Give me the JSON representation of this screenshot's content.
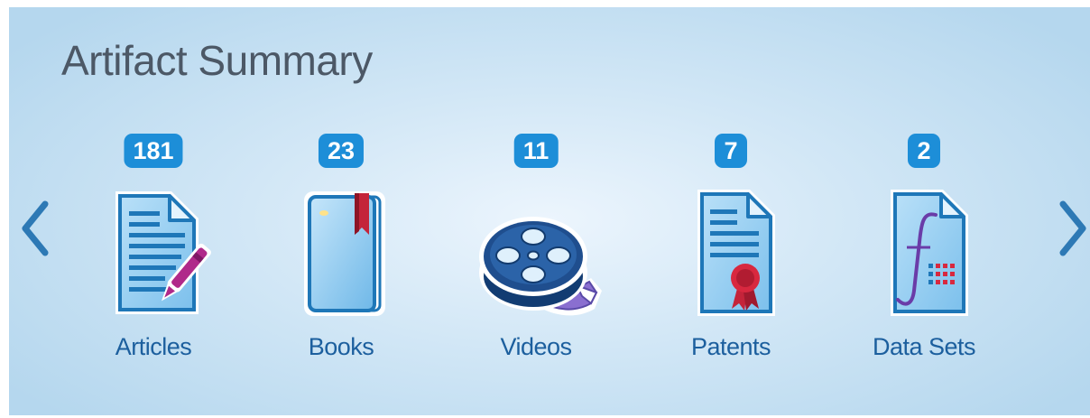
{
  "panel": {
    "title": "Artifact Summary"
  },
  "nav": {
    "prev_icon": "chevron-left-icon",
    "next_icon": "chevron-right-icon"
  },
  "colors": {
    "badge": "#1d8ed8",
    "label": "#1c5f9e",
    "title": "#4c5866",
    "arrow": "#2d79b5"
  },
  "artifacts": [
    {
      "label": "Articles",
      "count": "181",
      "icon": "article-icon"
    },
    {
      "label": "Books",
      "count": "23",
      "icon": "book-icon"
    },
    {
      "label": "Videos",
      "count": "11",
      "icon": "film-reel-icon"
    },
    {
      "label": "Patents",
      "count": "7",
      "icon": "patent-icon"
    },
    {
      "label": "Data Sets",
      "count": "2",
      "icon": "data-set-icon"
    }
  ]
}
